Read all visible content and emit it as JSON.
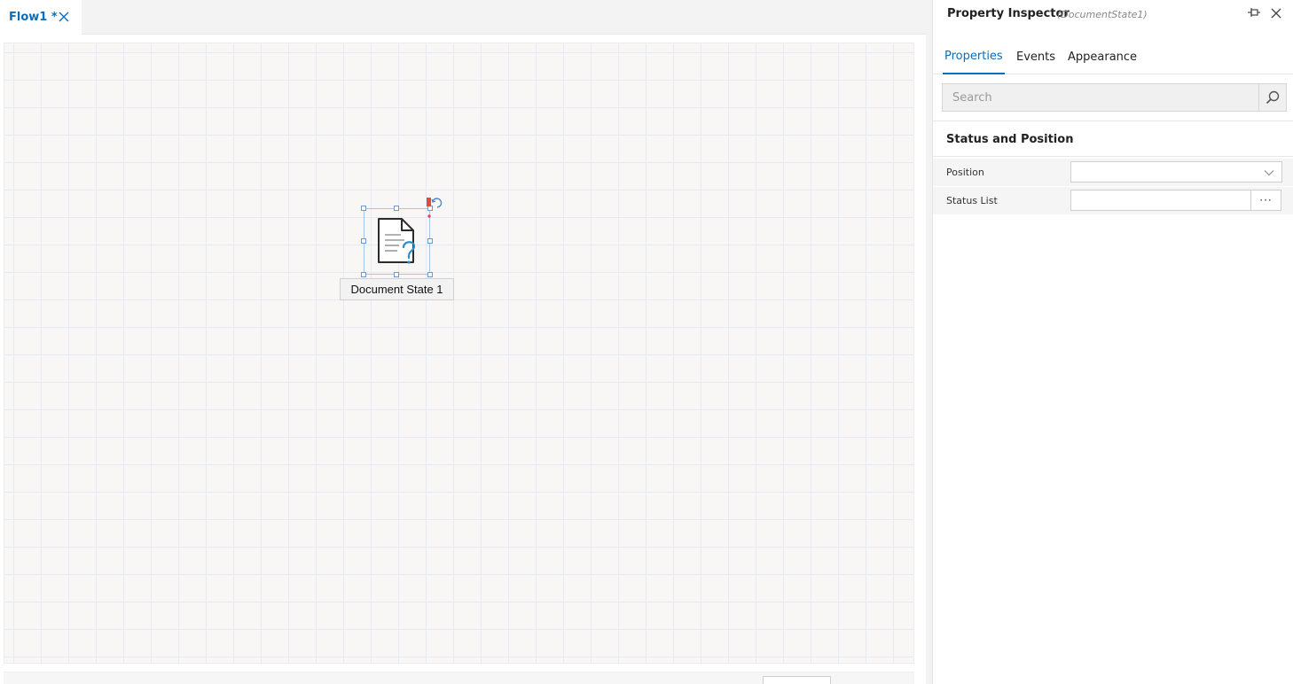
{
  "editor": {
    "tab_label": "Flow1 *"
  },
  "canvas": {
    "node_label": "Document State 1"
  },
  "inspector": {
    "title": "Property Inspector",
    "subtitle": "(DocumentState1)",
    "tabs": [
      {
        "label": "Properties",
        "active": true
      },
      {
        "label": "Events",
        "active": false
      },
      {
        "label": "Appearance",
        "active": false
      }
    ],
    "search": {
      "placeholder": "Search",
      "value": ""
    },
    "section_title": "Status and Position",
    "fields": [
      {
        "label": "Position",
        "value": ""
      },
      {
        "label": "Status List",
        "value": "",
        "button": "···"
      }
    ]
  },
  "colors": {
    "accent": "#0a6ebd",
    "grid": "#e6ebf3",
    "canvas_bg": "#f8f7f6",
    "selection": "#6d98d8",
    "flag": "#e04a3a"
  },
  "icons": [
    "close-icon",
    "document-question-icon",
    "flag-icon",
    "pin-icon",
    "search-icon",
    "chevron-down-icon"
  ]
}
